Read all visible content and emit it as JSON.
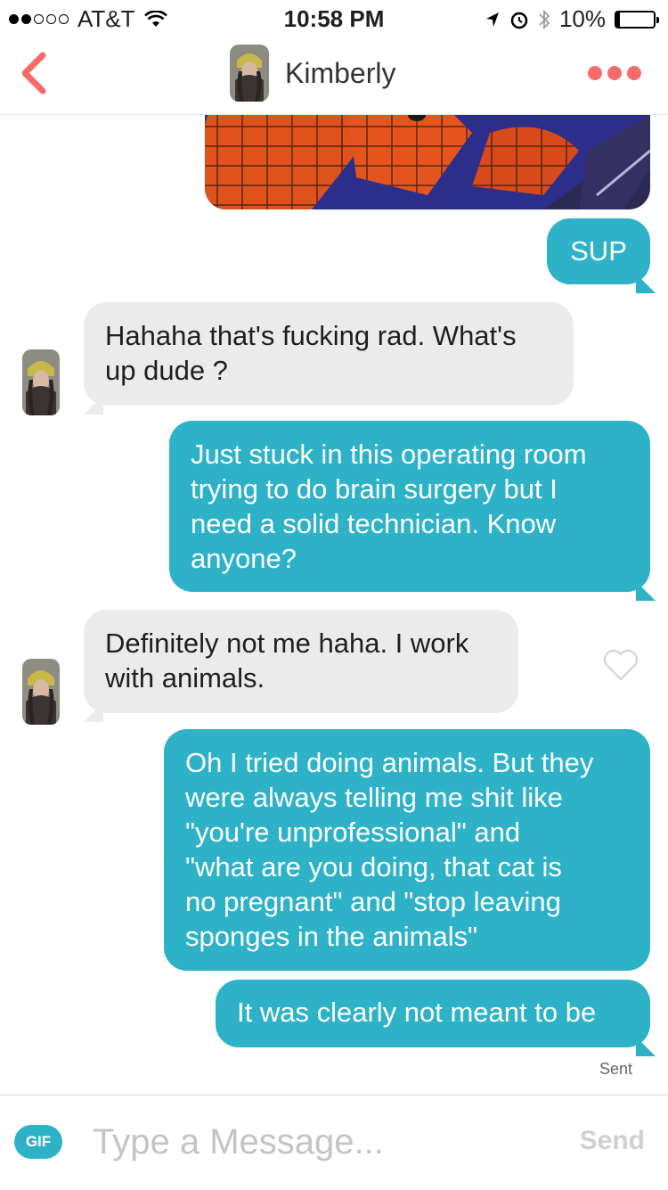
{
  "status_bar": {
    "carrier": "AT&T",
    "time": "10:58 PM",
    "battery": "10%",
    "battery_level": 0.1,
    "icons": [
      "signal-dots-icon",
      "wifi-icon",
      "location-arrow-icon",
      "alarm-icon",
      "bluetooth-icon",
      "battery-icon"
    ]
  },
  "header": {
    "name": "Kimberly",
    "back_icon": "chevron-left-icon",
    "more_icon": "more-dots-icon"
  },
  "messages": [
    {
      "from": "me",
      "type": "image",
      "description_icon": "image-attachment"
    },
    {
      "from": "me",
      "text": "SUP"
    },
    {
      "from": "match",
      "text_lines": [
        "Hahaha that's fucking rad. What's",
        "up dude ?"
      ]
    },
    {
      "from": "me",
      "text_lines": [
        "Just stuck in this operating room",
        "trying to do brain surgery but I",
        "need a solid technician. Know",
        "anyone?"
      ]
    },
    {
      "from": "match",
      "text_lines": [
        "Definitely not me haha. I work",
        "with animals."
      ]
    },
    {
      "from": "me",
      "text_lines": [
        "Oh I tried doing animals. But they",
        "were always telling me shit like",
        "\"you're unprofessional\" and",
        "\"what are you doing, that cat is",
        "no pregnant\" and \"stop leaving",
        "sponges in the animals\""
      ]
    },
    {
      "from": "me",
      "text": "It was clearly not meant to be"
    }
  ],
  "sent_label": "Sent",
  "input": {
    "gif_label": "GIF",
    "placeholder": "Type a Message...",
    "send_label": "Send"
  },
  "colors": {
    "outgoing_bubble": "#2db2c8",
    "incoming_bubble": "#ebebeb",
    "accent_red": "#f76a6a"
  }
}
